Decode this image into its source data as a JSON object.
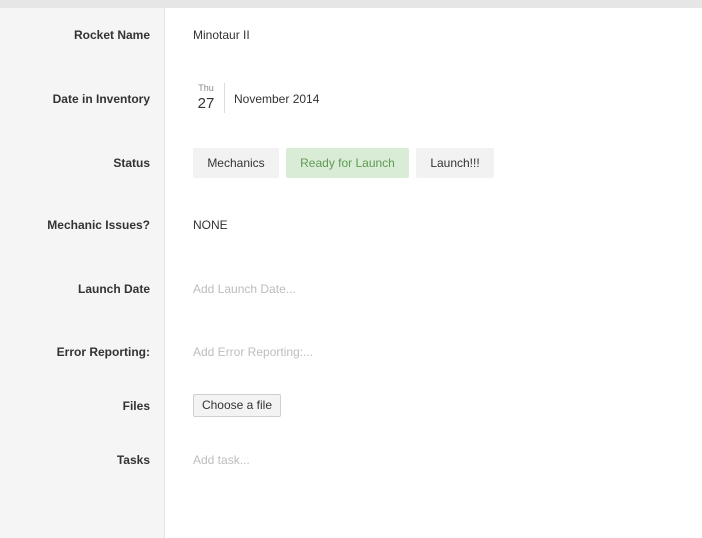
{
  "fields": {
    "rocket_name": {
      "label": "Rocket Name",
      "value": "Minotaur II"
    },
    "date_in_inventory": {
      "label": "Date in Inventory",
      "weekday": "Thu",
      "day": "27",
      "month_year": "November 2014"
    },
    "status": {
      "label": "Status",
      "options": [
        "Mechanics",
        "Ready for Launch",
        "Launch!!!"
      ],
      "selected": "Ready for Launch",
      "selected_color": "#d9ecd5"
    },
    "mechanic_issues": {
      "label": "Mechanic Issues?",
      "value": "NONE"
    },
    "launch_date": {
      "label": "Launch Date",
      "placeholder": "Add Launch Date..."
    },
    "error_reporting": {
      "label": "Error Reporting:",
      "placeholder": "Add Error Reporting:..."
    },
    "files": {
      "label": "Files",
      "button_label": "Choose a file"
    },
    "tasks": {
      "label": "Tasks",
      "placeholder": "Add task..."
    }
  }
}
